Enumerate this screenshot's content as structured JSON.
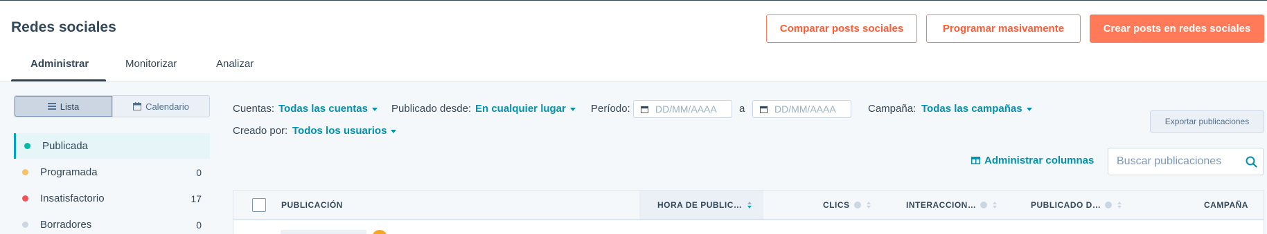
{
  "header": {
    "title": "Redes sociales",
    "buttons": {
      "compare": "Comparar posts sociales",
      "bulk": "Programar masivamente",
      "create": "Crear posts en redes sociales"
    },
    "tabs": [
      "Administrar",
      "Monitorizar",
      "Analizar"
    ]
  },
  "sidebar": {
    "view_toggle": {
      "list": "Lista",
      "calendar": "Calendario"
    },
    "statuses": [
      {
        "label": "Publicada",
        "count": "",
        "color": "#00bda5"
      },
      {
        "label": "Programada",
        "count": "0",
        "color": "#f5c26b"
      },
      {
        "label": "Insatisfactorio",
        "count": "17",
        "color": "#f2545b"
      },
      {
        "label": "Borradores",
        "count": "0",
        "color": "#cbd6e2"
      }
    ]
  },
  "filters": {
    "accounts_label": "Cuentas:",
    "accounts_value": "Todas las cuentas",
    "published_from_label": "Publicado desde:",
    "published_from_value": "En cualquier lugar",
    "period_label": "Período:",
    "date_placeholder": "DD/MM/AAAA",
    "to_label": "a",
    "campaign_label": "Campaña:",
    "campaign_value": "Todas las campañas",
    "created_by_label": "Creado por:",
    "created_by_value": "Todos los usuarios"
  },
  "actions": {
    "export": "Exportar publicaciones",
    "manage_columns": "Administrar columnas",
    "search_placeholder": "Buscar publicaciones"
  },
  "table": {
    "columns": {
      "post": "PUBLICACIÓN",
      "time": "HORA DE PUBLIC…",
      "clicks": "CLICS",
      "interactions": "INTERACCION…",
      "published_by": "PUBLICADO D…",
      "campaign": "CAMPAÑA"
    }
  },
  "colors": {
    "accent": "#ff7a59",
    "link": "#0091ae",
    "text": "#33475b"
  }
}
